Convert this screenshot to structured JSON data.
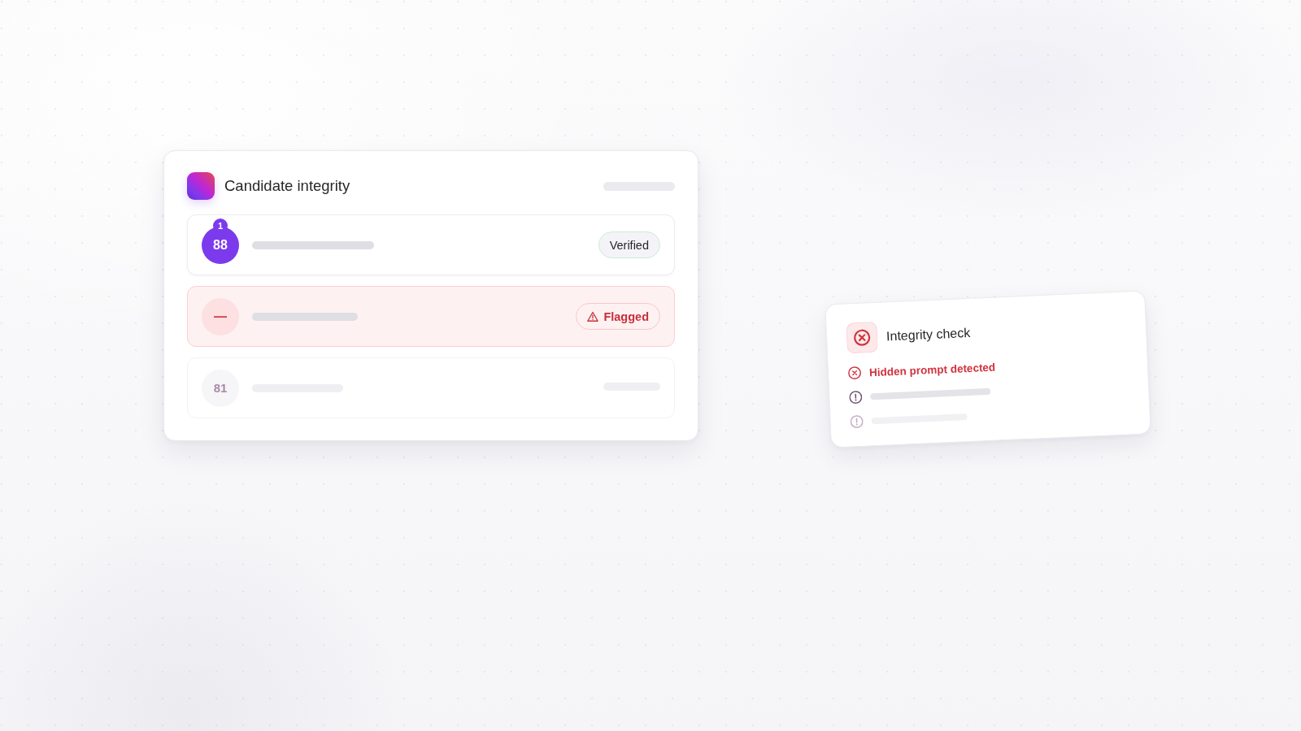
{
  "integrity_card": {
    "title": "Candidate integrity",
    "candidates": [
      {
        "kind": "verified",
        "score": "88",
        "badge": "1",
        "status": "Verified"
      },
      {
        "kind": "flagged",
        "score": "—",
        "status": "Flagged"
      },
      {
        "kind": "pending",
        "score": "81"
      }
    ]
  },
  "check_panel": {
    "title": "Integrity check",
    "findings": [
      {
        "kind": "error",
        "text": "Hidden prompt detected"
      },
      {
        "kind": "warning"
      },
      {
        "kind": "pending"
      }
    ]
  }
}
